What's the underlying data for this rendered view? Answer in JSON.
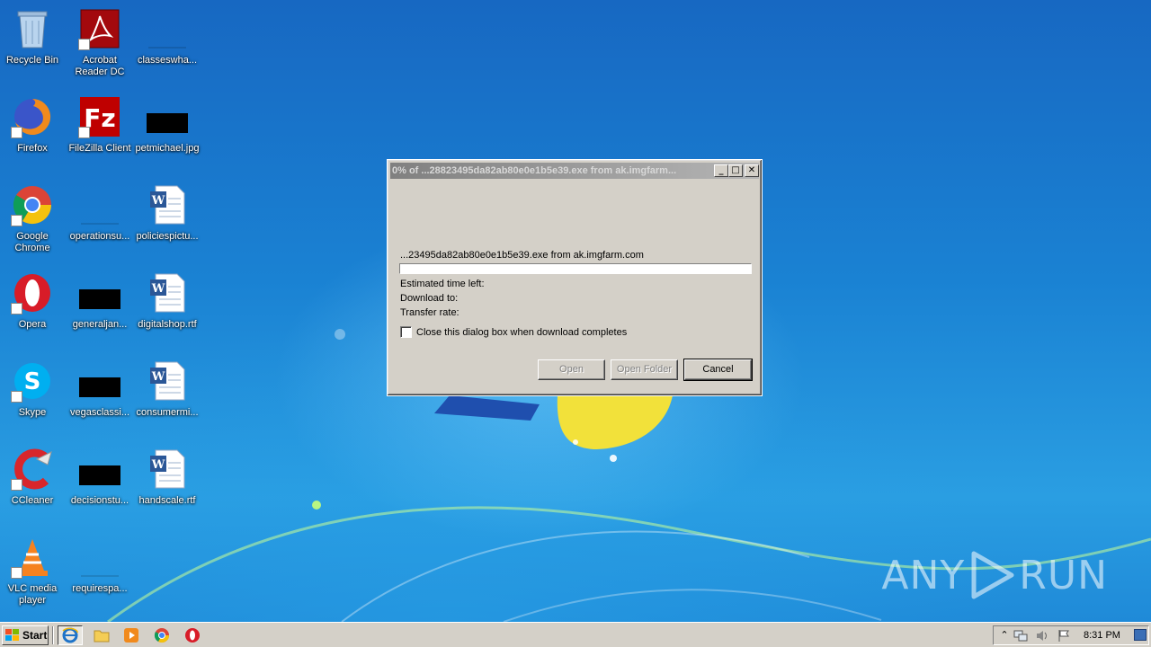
{
  "desktop": {
    "icons": [
      {
        "label": "Recycle Bin"
      },
      {
        "label": "Acrobat Reader DC"
      },
      {
        "label": "classeswha..."
      },
      {
        "label": "Firefox"
      },
      {
        "label": "FileZilla Client"
      },
      {
        "label": "petmichael.jpg"
      },
      {
        "label": "Google Chrome"
      },
      {
        "label": "operationsu..."
      },
      {
        "label": "policiespictu..."
      },
      {
        "label": "Opera"
      },
      {
        "label": "generaljan..."
      },
      {
        "label": "digitalshop.rtf"
      },
      {
        "label": "Skype"
      },
      {
        "label": "vegasclassi..."
      },
      {
        "label": "consumermi..."
      },
      {
        "label": "CCleaner"
      },
      {
        "label": "decisionstu..."
      },
      {
        "label": "handscale.rtf"
      },
      {
        "label": "VLC media player"
      },
      {
        "label": "requirespa..."
      }
    ]
  },
  "dialog": {
    "title": "0% of ...28823495da82ab80e0e1b5e39.exe from ak.imgfarm...",
    "file_text": "...23495da82ab80e0e1b5e39.exe from ak.imgfarm.com",
    "progress_fraction": 0,
    "estimated_time_label": "Estimated time left:",
    "download_to_label": "Download to:",
    "transfer_rate_label": "Transfer rate:",
    "close_checkbox_label": "Close this dialog box when download completes",
    "close_checkbox_checked": false,
    "open_button": "Open",
    "open_folder_button": "Open Folder",
    "cancel_button": "Cancel",
    "minimize_glyph": "_",
    "maximize_glyph": "□",
    "close_glyph": "✕"
  },
  "watermark": {
    "text_left": "ANY",
    "text_right": "RUN"
  },
  "taskbar": {
    "start_label": "Start",
    "clock": "8:31 PM",
    "tray_expand_glyph": "⌃"
  }
}
